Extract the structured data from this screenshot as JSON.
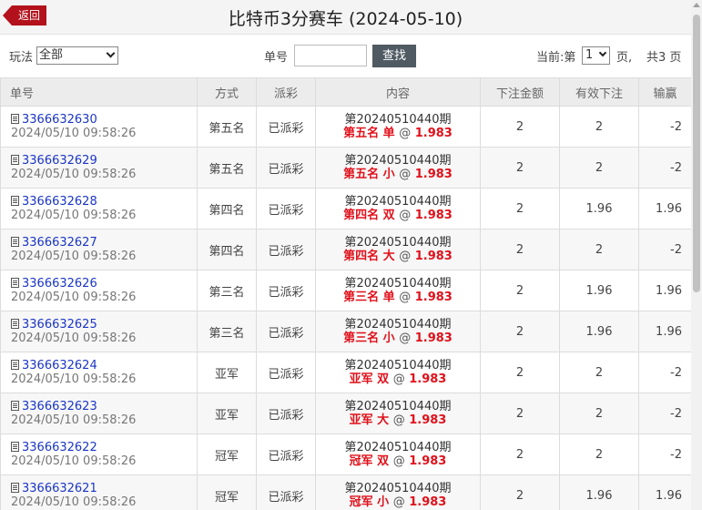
{
  "header": {
    "back_label": "返回",
    "title": "比特币3分赛车 (2024-05-10)"
  },
  "toolbar": {
    "play_label": "玩法",
    "play_selected": "全部",
    "order_label": "单号",
    "order_value": "",
    "search_label": "查找",
    "page_prefix": "当前:第",
    "page_current": "1",
    "page_suffix": "页,",
    "page_total": "共3 页"
  },
  "table": {
    "headers": [
      "单号",
      "方式",
      "派彩",
      "内容",
      "下注金额",
      "有效下注",
      "输赢"
    ],
    "rows": [
      {
        "id": "3366632630",
        "time": "2024/05/10 09:58:26",
        "type": "第五名",
        "status": "已派彩",
        "period": "第20240510440期",
        "pick": "第五名 单",
        "at": "@",
        "odds": "1.983",
        "amount": "2",
        "valid": "2",
        "result": "-2"
      },
      {
        "id": "3366632629",
        "time": "2024/05/10 09:58:26",
        "type": "第五名",
        "status": "已派彩",
        "period": "第20240510440期",
        "pick": "第五名 小",
        "at": "@",
        "odds": "1.983",
        "amount": "2",
        "valid": "2",
        "result": "-2"
      },
      {
        "id": "3366632628",
        "time": "2024/05/10 09:58:26",
        "type": "第四名",
        "status": "已派彩",
        "period": "第20240510440期",
        "pick": "第四名 双",
        "at": "@",
        "odds": "1.983",
        "amount": "2",
        "valid": "1.96",
        "result": "1.96"
      },
      {
        "id": "3366632627",
        "time": "2024/05/10 09:58:26",
        "type": "第四名",
        "status": "已派彩",
        "period": "第20240510440期",
        "pick": "第四名 大",
        "at": "@",
        "odds": "1.983",
        "amount": "2",
        "valid": "2",
        "result": "-2"
      },
      {
        "id": "3366632626",
        "time": "2024/05/10 09:58:26",
        "type": "第三名",
        "status": "已派彩",
        "period": "第20240510440期",
        "pick": "第三名 单",
        "at": "@",
        "odds": "1.983",
        "amount": "2",
        "valid": "1.96",
        "result": "1.96"
      },
      {
        "id": "3366632625",
        "time": "2024/05/10 09:58:26",
        "type": "第三名",
        "status": "已派彩",
        "period": "第20240510440期",
        "pick": "第三名 小",
        "at": "@",
        "odds": "1.983",
        "amount": "2",
        "valid": "1.96",
        "result": "1.96"
      },
      {
        "id": "3366632624",
        "time": "2024/05/10 09:58:26",
        "type": "亚军",
        "status": "已派彩",
        "period": "第20240510440期",
        "pick": "亚军 双",
        "at": "@",
        "odds": "1.983",
        "amount": "2",
        "valid": "2",
        "result": "-2"
      },
      {
        "id": "3366632623",
        "time": "2024/05/10 09:58:26",
        "type": "亚军",
        "status": "已派彩",
        "period": "第20240510440期",
        "pick": "亚军 大",
        "at": "@",
        "odds": "1.983",
        "amount": "2",
        "valid": "2",
        "result": "-2"
      },
      {
        "id": "3366632622",
        "time": "2024/05/10 09:58:26",
        "type": "冠军",
        "status": "已派彩",
        "period": "第20240510440期",
        "pick": "冠军 双",
        "at": "@",
        "odds": "1.983",
        "amount": "2",
        "valid": "2",
        "result": "-2"
      },
      {
        "id": "3366632621",
        "time": "2024/05/10 09:58:26",
        "type": "冠军",
        "status": "已派彩",
        "period": "第20240510440期",
        "pick": "冠军 小",
        "at": "@",
        "odds": "1.983",
        "amount": "2",
        "valid": "1.96",
        "result": "1.96"
      }
    ]
  },
  "colors": {
    "accent": "#b3121c",
    "link": "#1a35c8",
    "loss": "#e0111b",
    "button": "#4f5a63"
  }
}
